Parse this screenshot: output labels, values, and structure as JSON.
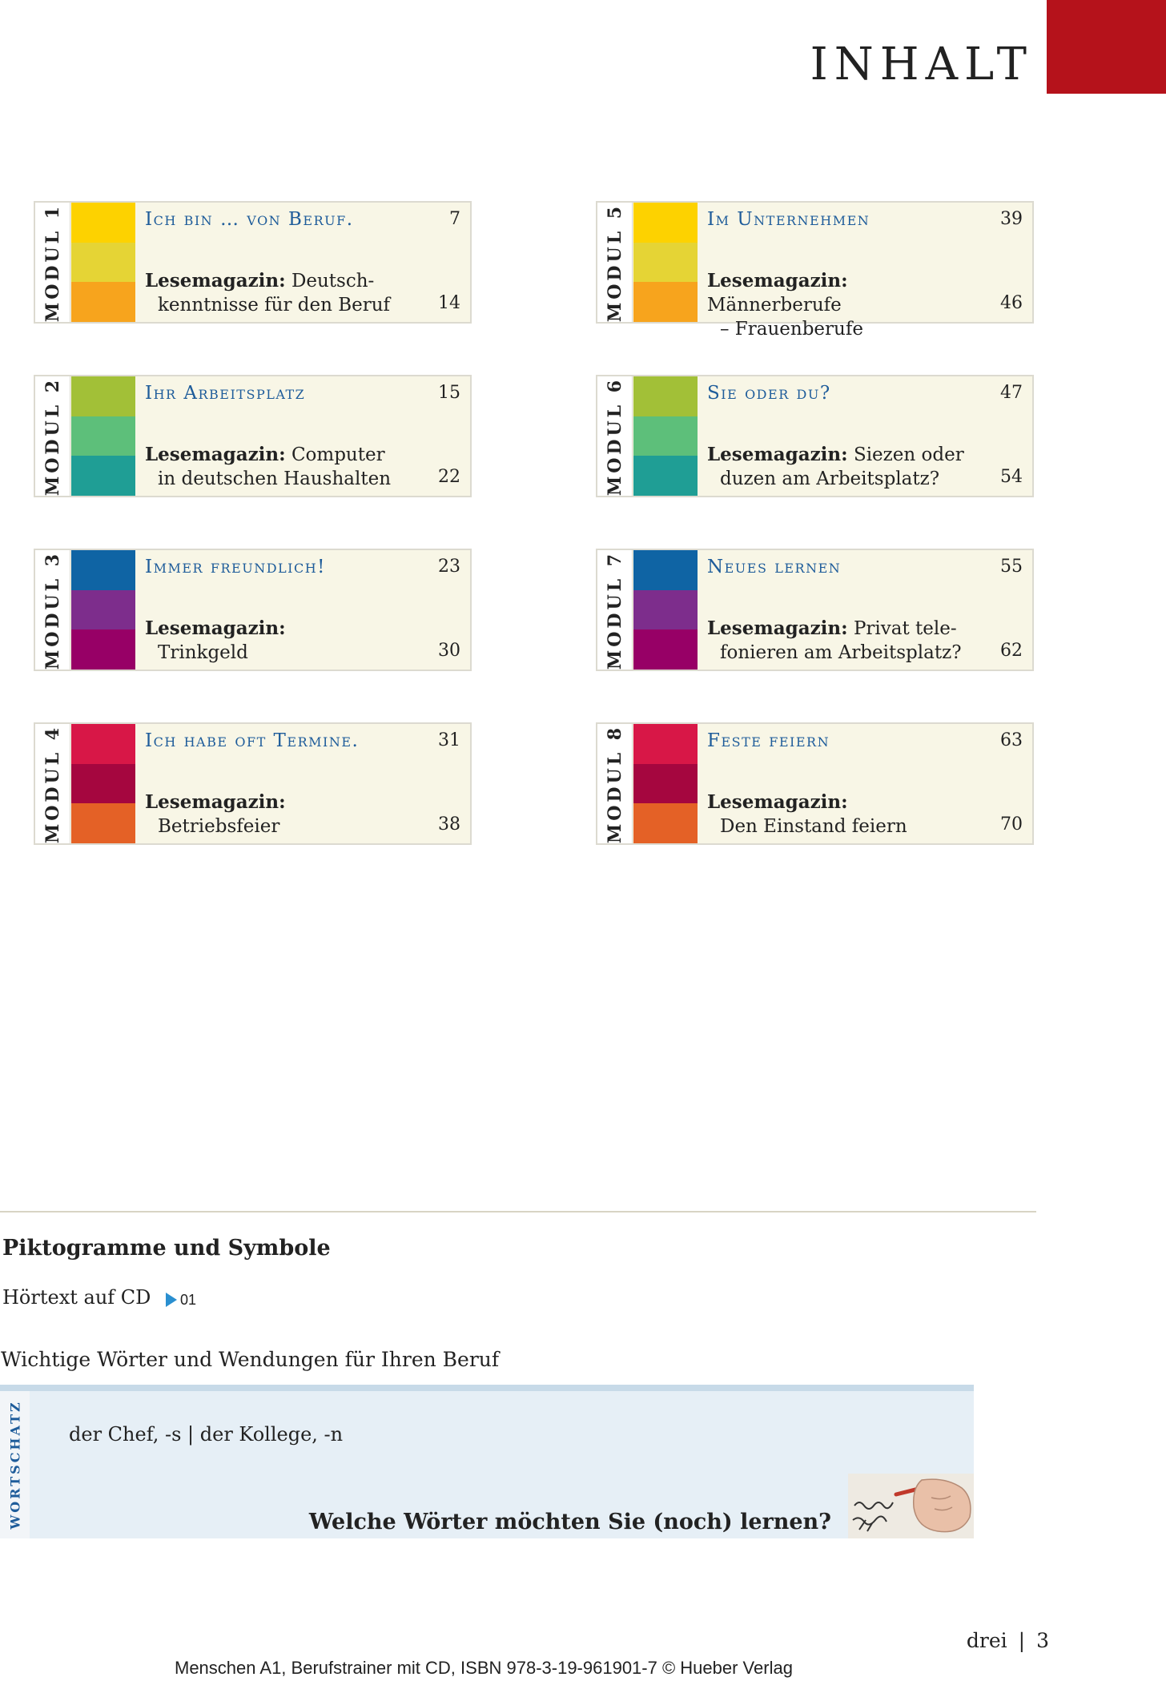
{
  "header": {
    "title": "INHALT",
    "accent_color": "#b5121b"
  },
  "modules": [
    {
      "label": "MODUL 1",
      "colors": [
        "#fdd200",
        "#e5d435",
        "#f7a41d"
      ],
      "topic": "Ich bin … von Beruf.",
      "topic_page": "7",
      "lese_label": "Lesemagazin:",
      "lese_line1": "Deutsch-",
      "lese_line2": "kenntnisse für den Beruf",
      "lese_page": "14"
    },
    {
      "label": "MODUL 2",
      "colors": [
        "#a2c037",
        "#5dbf7a",
        "#1f9e95"
      ],
      "topic": "Ihr Arbeitsplatz",
      "topic_page": "15",
      "lese_label": "Lesemagazin:",
      "lese_line1": "Computer",
      "lese_line2": "in deutschen Haushalten",
      "lese_page": "22"
    },
    {
      "label": "MODUL 3",
      "colors": [
        "#0f64a4",
        "#7d2d8c",
        "#970066"
      ],
      "topic": "Immer freundlich!",
      "topic_page": "23",
      "lese_label": "Lesemagazin:",
      "lese_line1": "",
      "lese_line2": "Trinkgeld",
      "lese_page": "30"
    },
    {
      "label": "MODUL 4",
      "colors": [
        "#d81747",
        "#a5063f",
        "#e46126"
      ],
      "topic": "Ich habe oft Termine.",
      "topic_page": "31",
      "lese_label": "Lesemagazin:",
      "lese_line1": "",
      "lese_line2": "Betriebsfeier",
      "lese_page": "38"
    },
    {
      "label": "MODUL 5",
      "colors": [
        "#fdd200",
        "#e5d435",
        "#f7a41d"
      ],
      "topic": "Im Unternehmen",
      "topic_page": "39",
      "lese_label": "Lesemagazin:",
      "lese_line1": "Männerberufe",
      "lese_line2": "– Frauenberufe",
      "lese_page": "46"
    },
    {
      "label": "MODUL 6",
      "colors": [
        "#a2c037",
        "#5dbf7a",
        "#1f9e95"
      ],
      "topic": "Sie oder du?",
      "topic_page": "47",
      "lese_label": "Lesemagazin:",
      "lese_line1": "Siezen oder",
      "lese_line2": "duzen am Arbeitsplatz?",
      "lese_page": "54"
    },
    {
      "label": "MODUL 7",
      "colors": [
        "#0f64a4",
        "#7d2d8c",
        "#970066"
      ],
      "topic": "Neues lernen",
      "topic_page": "55",
      "lese_label": "Lesemagazin:",
      "lese_line1": "Privat tele-",
      "lese_line2": "fonieren am Arbeitsplatz?",
      "lese_page": "62"
    },
    {
      "label": "MODUL 8",
      "colors": [
        "#d81747",
        "#a5063f",
        "#e46126"
      ],
      "topic": "Feste feiern",
      "topic_page": "63",
      "lese_label": "Lesemagazin:",
      "lese_line1": "",
      "lese_line2": "Den Einstand feiern",
      "lese_page": "70"
    }
  ],
  "pictograms": {
    "title": "Piktogramme und Symbole",
    "hoertext_label": "Hörtext auf CD",
    "cd_track": "01",
    "wichtig_label": "Wichtige Wörter und Wendungen für Ihren Beruf",
    "wortschatz_label": "WORTSCHATZ",
    "wortschatz_example": "der Chef, -s | der Kollege, -n",
    "wortschatz_question": "Welche Wörter möchten Sie (noch) lernen?"
  },
  "footer": {
    "page_word": "drei",
    "page_number": "3",
    "credit": "Menschen A1, Berufstrainer mit CD, ISBN 978-3-19-961901-7 © Hueber Verlag"
  }
}
